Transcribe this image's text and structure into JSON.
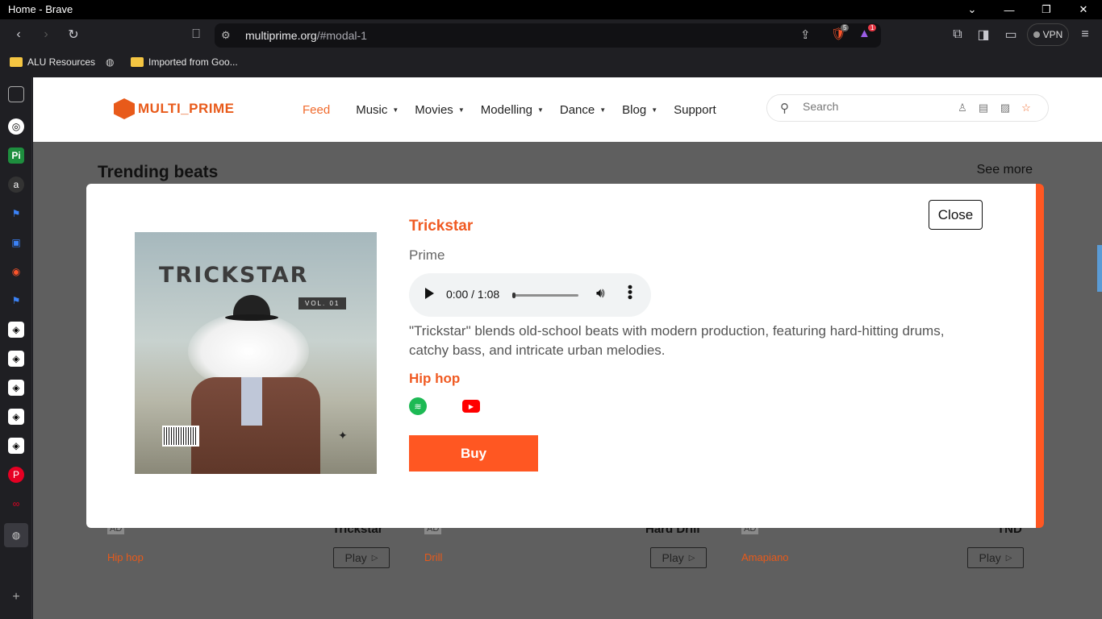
{
  "window": {
    "title": "Home - Brave",
    "controls": [
      "chevron-down",
      "minimize",
      "restore",
      "close"
    ]
  },
  "toolbar": {
    "url_domain": "multiprime.org",
    "url_path": "/#modal-1",
    "brave_shield_count": "5",
    "rewards_count": "1",
    "vpn_label": "VPN"
  },
  "bookmarks": [
    {
      "label": "ALU Resources",
      "icon": "folder-icon"
    },
    {
      "label": "",
      "icon": "globe-icon"
    },
    {
      "label": "Imported from Goo...",
      "icon": "folder-icon"
    }
  ],
  "site": {
    "logo_text": "MULTI_PRIME",
    "nav": [
      {
        "label": "Feed",
        "active": true,
        "caret": false
      },
      {
        "label": "Music",
        "caret": true
      },
      {
        "label": "Movies",
        "caret": true
      },
      {
        "label": "Modelling",
        "caret": true
      },
      {
        "label": "Dance",
        "caret": true
      },
      {
        "label": "Blog",
        "caret": true
      },
      {
        "label": "Support",
        "caret": false
      }
    ],
    "search_placeholder": "Search",
    "section_title": "Trending beats",
    "see_more": "See more",
    "cards": [
      {
        "ad": "AD",
        "name": "Trickstar",
        "genre": "Hip hop",
        "play": "Play"
      },
      {
        "ad": "AD",
        "name": "Hard Drill",
        "genre": "Drill",
        "play": "Play"
      },
      {
        "ad": "AD",
        "name": "TND",
        "genre": "Amapiano",
        "play": "Play"
      }
    ]
  },
  "modal": {
    "close_label": "Close",
    "title": "Trickstar",
    "artist": "Prime",
    "cover_title": "TRICKSTAR",
    "cover_vol": "VOL. 01",
    "player_time": "0:00 / 1:08",
    "player_progress": 0.0,
    "description": "\"Trickstar\" blends old-school beats with modern production, featuring hard-hitting drums, catchy bass, and intricate urban melodies.",
    "genre": "Hip hop",
    "streaming": [
      "spotify-icon",
      "apple-music-icon",
      "youtube-icon"
    ],
    "buy_label": "Buy"
  },
  "colors": {
    "accent": "#ff5722",
    "nav_active": "#f06a2c",
    "title_orange": "#f05a22"
  }
}
